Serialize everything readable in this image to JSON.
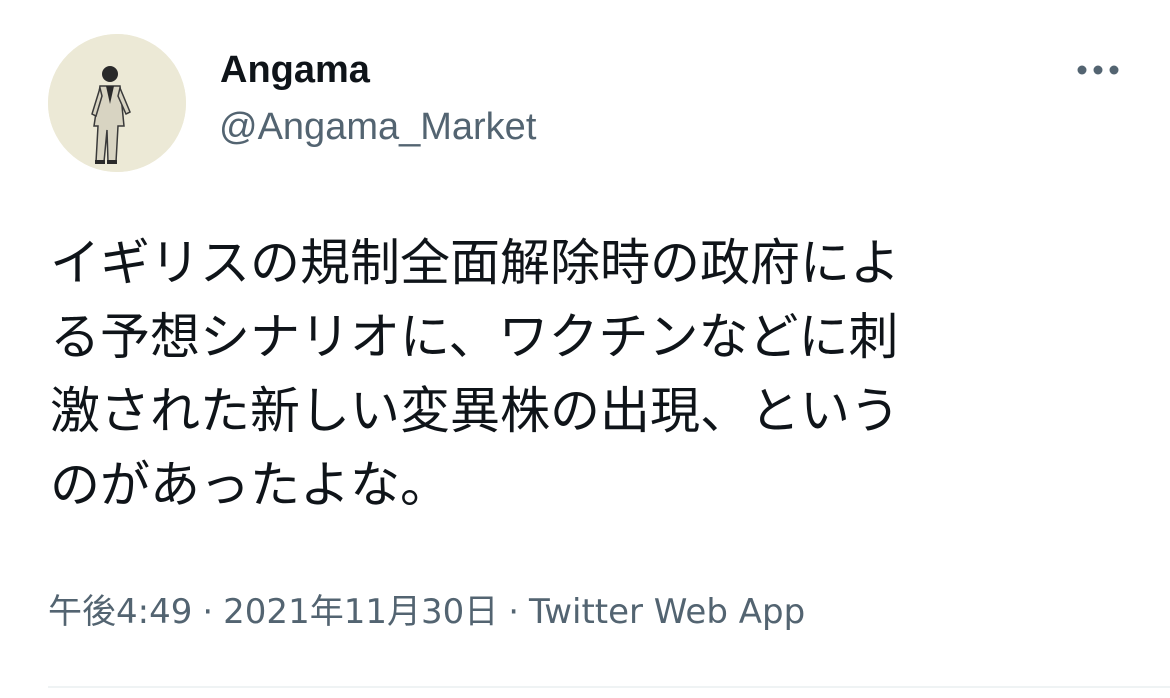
{
  "author": {
    "display_name": "Angama",
    "handle": "@Angama_Market",
    "avatar_icon": "profile-photo"
  },
  "more_icon": "more-horizontal-icon",
  "tweet": {
    "text_lines": [
      "イギリスの規制全面解除時の政府によ",
      "る予想シナリオに、ワクチンなどに刺",
      "激された新しい変異株の出現、という",
      "のがあったよな。"
    ]
  },
  "meta": {
    "time": "午後4:49",
    "separator": "·",
    "date": "2021年11月30日",
    "source": "Twitter Web App"
  },
  "colors": {
    "text_primary": "#0f1419",
    "text_secondary": "#536471",
    "avatar_bg": "#ece9d6",
    "divider": "#eff3f4"
  }
}
